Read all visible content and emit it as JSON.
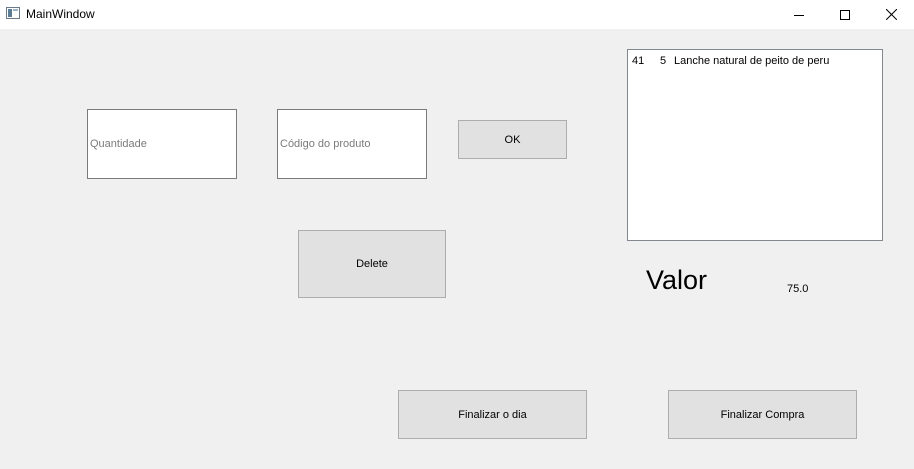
{
  "window": {
    "title": "MainWindow",
    "icon": "app-window-icon",
    "controls": {
      "minimize_icon": "minimize-icon",
      "maximize_icon": "maximize-icon",
      "close_icon": "close-icon"
    }
  },
  "form": {
    "quantity_placeholder": "Quantidade",
    "code_placeholder": "Código do produto",
    "ok_label": "OK",
    "delete_label": "Delete",
    "finish_day_label": "Finalizar o dia",
    "finish_purchase_label": "Finalizar Compra"
  },
  "cart": {
    "items": [
      {
        "quantity": "41",
        "code": "5",
        "name": "Lanche natural de peito de peru"
      }
    ]
  },
  "total": {
    "label": "Valor",
    "value": "75.0"
  },
  "colors": {
    "window_bg": "#f0f0f0",
    "titlebar_bg": "#ffffff",
    "button_bg": "#e1e1e1",
    "button_border": "#adadad"
  }
}
